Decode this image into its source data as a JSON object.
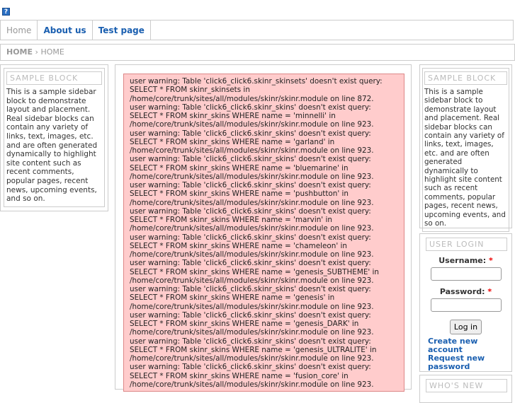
{
  "logo": {
    "glyph": "?"
  },
  "nav": {
    "home": "Home",
    "about": "About us",
    "test": "Test page"
  },
  "breadcrumb": {
    "home": "HOME",
    "separator": "›",
    "current": "HOME"
  },
  "left_block": {
    "title": "SAMPLE BLOCK",
    "text": "This is a sample sidebar block to demonstrate layout and placement. Real sidebar blocks can contain any variety of links, text, images, etc. and are often generated dynamically to highlight site content such as recent comments, popular pages, recent news, upcoming events, and so on."
  },
  "right_block": {
    "title": "SAMPLE BLOCK",
    "text": "This is a sample sidebar block to demonstrate layout and placement. Real sidebar blocks can contain any variety of links, text, images, etc. and are often generated dynamically to highlight site content such as recent comments, popular pages, recent news, upcoming events, and so on."
  },
  "login": {
    "title": "USER LOGIN",
    "username_label": "Username:",
    "password_label": "Password:",
    "required": "*",
    "button": "Log in",
    "create_account": "Create new account",
    "request_password": "Request new password"
  },
  "whos_new": {
    "title": "WHO'S NEW"
  },
  "warnings": [
    "user warning: Table 'click6_click6.skinr_skinsets' doesn't exist query: SELECT * FROM skinr_skinsets in /home/core/trunk/sites/all/modules/skinr/skinr.module on line 872.",
    "user warning: Table 'click6_click6.skinr_skins' doesn't exist query: SELECT * FROM skinr_skins WHERE name = 'minnelli' in /home/core/trunk/sites/all/modules/skinr/skinr.module on line 923.",
    "user warning: Table 'click6_click6.skinr_skins' doesn't exist query: SELECT * FROM skinr_skins WHERE name = 'garland' in /home/core/trunk/sites/all/modules/skinr/skinr.module on line 923.",
    "user warning: Table 'click6_click6.skinr_skins' doesn't exist query: SELECT * FROM skinr_skins WHERE name = 'bluemarine' in /home/core/trunk/sites/all/modules/skinr/skinr.module on line 923.",
    "user warning: Table 'click6_click6.skinr_skins' doesn't exist query: SELECT * FROM skinr_skins WHERE name = 'pushbutton' in /home/core/trunk/sites/all/modules/skinr/skinr.module on line 923.",
    "user warning: Table 'click6_click6.skinr_skins' doesn't exist query: SELECT * FROM skinr_skins WHERE name = 'marvin' in /home/core/trunk/sites/all/modules/skinr/skinr.module on line 923.",
    "user warning: Table 'click6_click6.skinr_skins' doesn't exist query: SELECT * FROM skinr_skins WHERE name = 'chameleon' in /home/core/trunk/sites/all/modules/skinr/skinr.module on line 923.",
    "user warning: Table 'click6_click6.skinr_skins' doesn't exist query: SELECT * FROM skinr_skins WHERE name = 'genesis_SUBTHEME' in /home/core/trunk/sites/all/modules/skinr/skinr.module on line 923.",
    "user warning: Table 'click6_click6.skinr_skins' doesn't exist query: SELECT * FROM skinr_skins WHERE name = 'genesis' in /home/core/trunk/sites/all/modules/skinr/skinr.module on line 923.",
    "user warning: Table 'click6_click6.skinr_skins' doesn't exist query: SELECT * FROM skinr_skins WHERE name = 'genesis_DARK' in /home/core/trunk/sites/all/modules/skinr/skinr.module on line 923.",
    "user warning: Table 'click6_click6.skinr_skins' doesn't exist query: SELECT * FROM skinr_skins WHERE name = 'genesis_ULTRALITE' in /home/core/trunk/sites/all/modules/skinr/skinr.module on line 923.",
    "user warning: Table 'click6_click6.skinr_skins' doesn't exist query: SELECT * FROM skinr_skins WHERE name = 'fusion_core' in /home/core/trunk/sites/all/modules/skinr/skinr.module on line 923."
  ]
}
